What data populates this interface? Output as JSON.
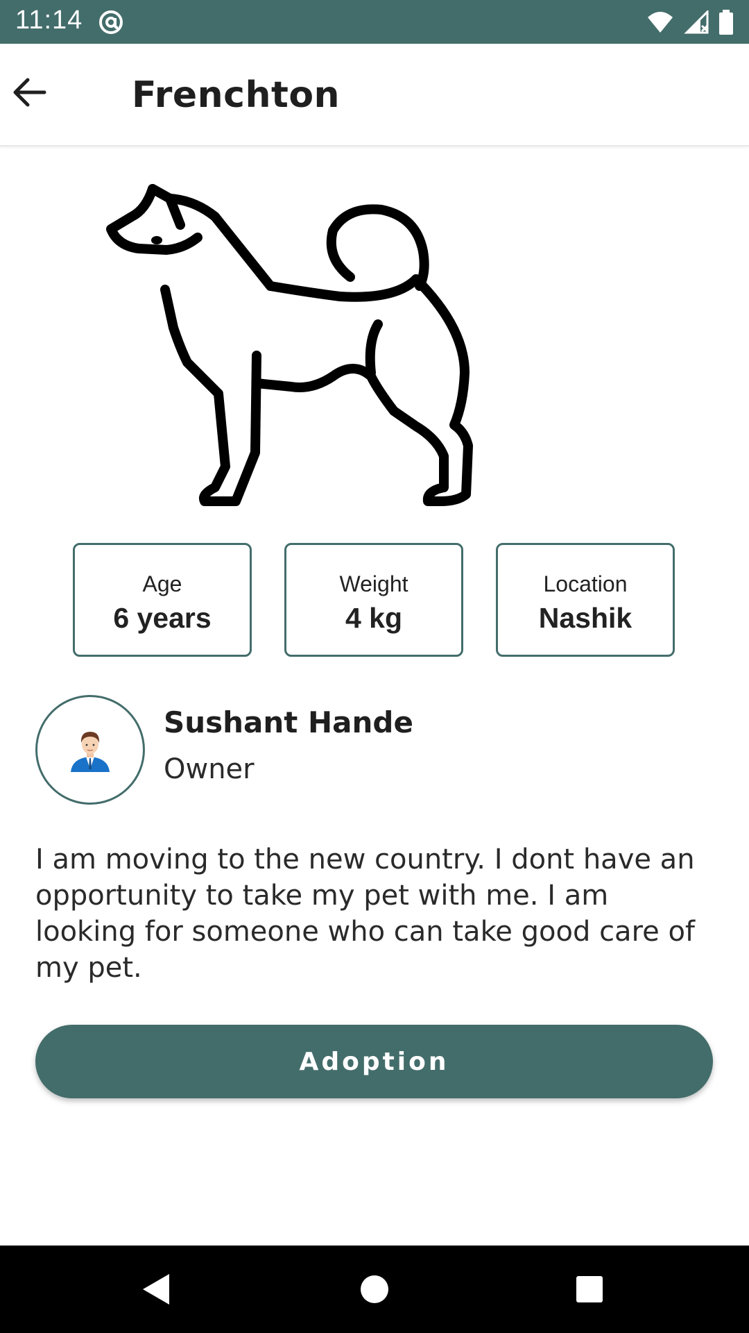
{
  "status_bar": {
    "time": "11:14",
    "icons": [
      "at-sign-icon",
      "wifi-icon",
      "signal-icon",
      "battery-icon"
    ]
  },
  "app_bar": {
    "title": "Frenchton",
    "back_icon": "arrow-left-icon"
  },
  "pet": {
    "image_icon": "dog-illustration",
    "stats": [
      {
        "label": "Age",
        "value": "6 years"
      },
      {
        "label": "Weight",
        "value": "4 kg"
      },
      {
        "label": "Location",
        "value": "Nashik"
      }
    ]
  },
  "owner": {
    "name": "Sushant Hande",
    "role": "Owner",
    "avatar_icon": "person-avatar-icon"
  },
  "description": "I am moving to the new country. I dont have an opportunity to take my pet with me. I am looking for someone who can take good care of my pet.",
  "actions": {
    "adopt_label": "Adoption"
  },
  "nav_bar": {
    "icons": [
      "back-triangle-icon",
      "home-circle-icon",
      "recents-square-icon"
    ]
  },
  "colors": {
    "accent": "#436d6b",
    "background": "#ffffff",
    "nav_bar": "#000000"
  }
}
